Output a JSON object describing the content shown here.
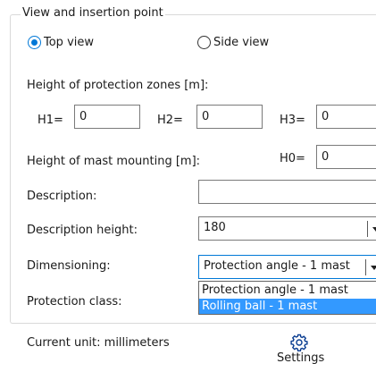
{
  "group": {
    "title": "View and insertion point"
  },
  "view": {
    "top_view_label": "Top view",
    "side_view_label": "Side view",
    "selected": "top"
  },
  "protection_zones": {
    "label": "Height of protection zones [m]:",
    "h1_label": "H1=",
    "h1_value": "0",
    "h2_label": "H2=",
    "h2_value": "0",
    "h3_label": "H3=",
    "h3_value": "0"
  },
  "mast_mounting": {
    "label": "Height of mast mounting [m]:",
    "h0_label": "H0=",
    "h0_value": "0"
  },
  "description": {
    "label": "Description:",
    "value": ""
  },
  "description_height": {
    "label": "Description height:",
    "value": "180"
  },
  "dimensioning": {
    "label": "Dimensioning:",
    "value": "Protection angle - 1 mast",
    "options": [
      "Protection angle - 1 mast",
      "Rolling ball - 1 mast"
    ],
    "highlighted_option": "Rolling ball - 1 mast"
  },
  "protection_class": {
    "label": "Protection class:"
  },
  "footer": {
    "current_unit": "Current unit: millimeters",
    "settings_label": "Settings",
    "settings_icon": "gear-icon"
  },
  "colors": {
    "accent": "#0078d7",
    "selection": "#3399ff"
  }
}
